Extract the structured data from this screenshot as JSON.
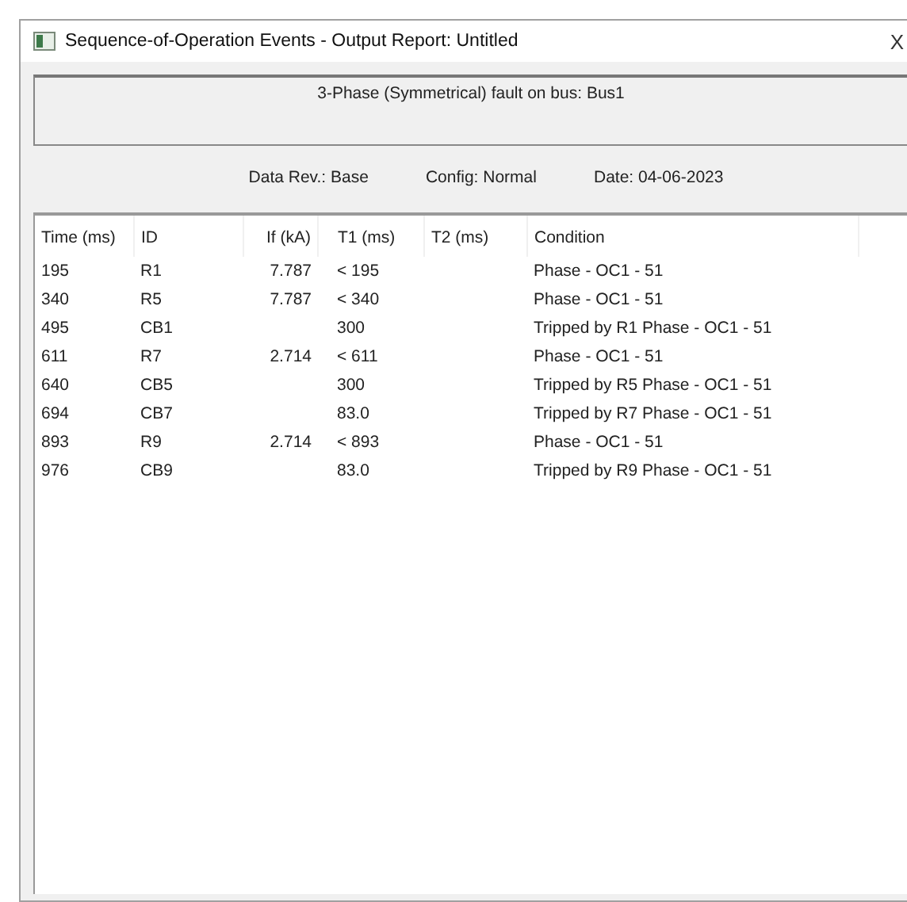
{
  "window": {
    "title": "Sequence-of-Operation Events - Output Report: Untitled",
    "close": "X"
  },
  "header": {
    "title": "3-Phase (Symmetrical) fault on bus: Bus1"
  },
  "info": [
    {
      "label": "Data Rev.:",
      "value": "Base"
    },
    {
      "label": "Config:",
      "value": "Normal"
    },
    {
      "label": "Date:",
      "value": "04-06-2023"
    }
  ],
  "table": {
    "columns": [
      "Time (ms)",
      "ID",
      "If (kA)",
      "T1 (ms)",
      "T2 (ms)",
      "Condition"
    ],
    "rows": [
      [
        "195",
        "R1",
        "7.787",
        "< 195",
        "",
        "Phase - OC1 - 51"
      ],
      [
        "340",
        "R5",
        "7.787",
        "< 340",
        "",
        "Phase - OC1 - 51"
      ],
      [
        "495",
        "CB1",
        "",
        "300",
        "",
        "Tripped by R1 Phase - OC1 - 51"
      ],
      [
        "611",
        "R7",
        "2.714",
        "< 611",
        "",
        "Phase - OC1 - 51"
      ],
      [
        "640",
        "CB5",
        "",
        "300",
        "",
        "Tripped by R5 Phase - OC1 - 51"
      ],
      [
        "694",
        "CB7",
        "",
        "83.0",
        "",
        "Tripped by R7 Phase - OC1 - 51"
      ],
      [
        "893",
        "R9",
        "2.714",
        "< 893",
        "",
        "Phase - OC1 - 51"
      ],
      [
        "976",
        "CB9",
        "",
        "83.0",
        "",
        "Tripped by R9 Phase - OC1 - 51"
      ]
    ]
  }
}
